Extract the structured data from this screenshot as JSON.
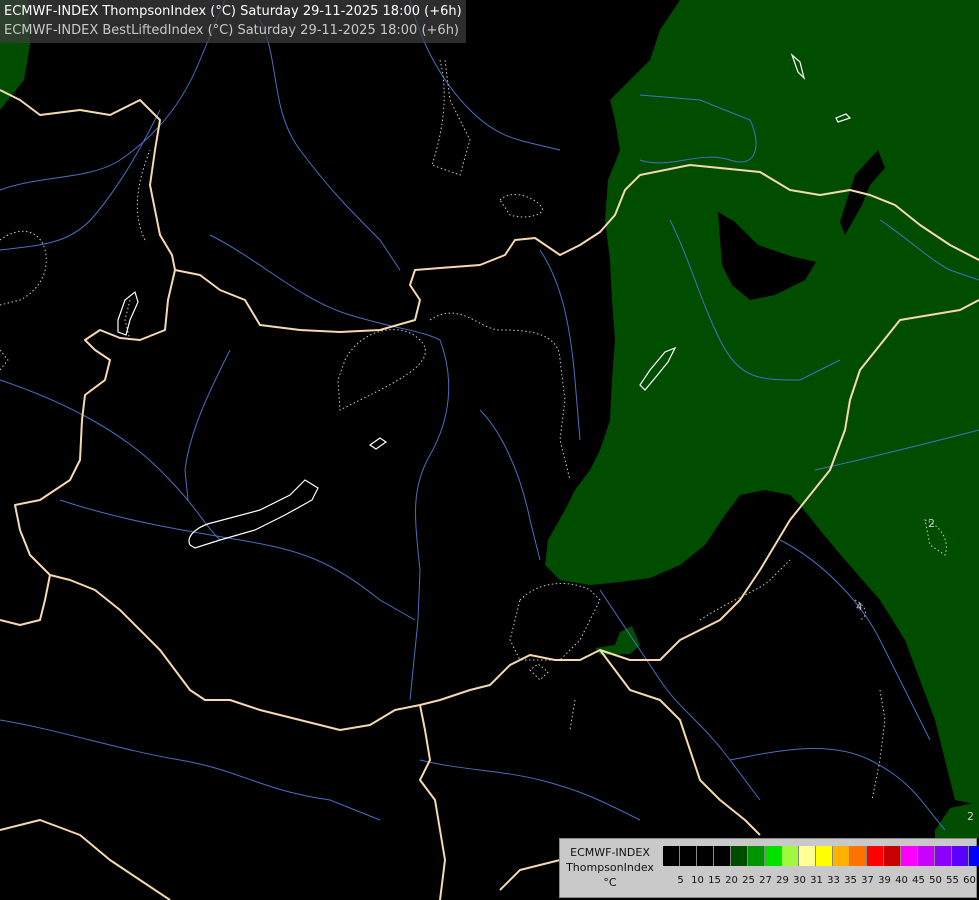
{
  "header": {
    "line1": "ECMWF-INDEX ThompsonIndex (°C) Saturday 29-11-2025 18:00 (+6h)",
    "line2": "ECMWF-INDEX BestLiftedIndex (°C) Saturday 29-11-2025 18:00 (+6h)"
  },
  "map": {
    "background_color": "#000000",
    "field_color": "#004d00",
    "border_color": "#f5d9b0",
    "river_color": "#4a6fc0",
    "contour_color": "#cccccc",
    "contour_labels": [
      "2",
      "4",
      "2"
    ]
  },
  "legend": {
    "title": [
      "ECMWF-INDEX",
      "ThompsonIndex",
      "°C"
    ],
    "colors": [
      "#000000",
      "#000000",
      "#000000",
      "#000000",
      "#004d00",
      "#009400",
      "#00e100",
      "#9ff93c",
      "#ffff96",
      "#ffff00",
      "#ffb300",
      "#ff7300",
      "#ff0000",
      "#c80000",
      "#ff00ff",
      "#c800ff",
      "#8b00ff",
      "#5a00ff",
      "#0000ff"
    ],
    "ticks": [
      "5",
      "10",
      "15",
      "20",
      "25",
      "27",
      "29",
      "30",
      "31",
      "33",
      "35",
      "37",
      "39",
      "40",
      "45",
      "50",
      "55",
      "60"
    ]
  }
}
